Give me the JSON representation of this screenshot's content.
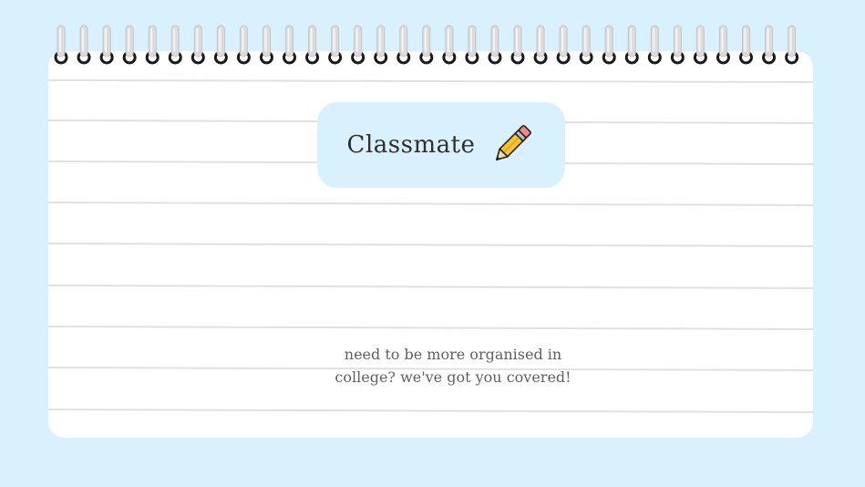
{
  "colors": {
    "background": "#d9f1fc",
    "paper": "#ffffff",
    "rule_line": "#e1e1e1",
    "title_card": "#d9f1fc",
    "spiral_ring": "#d8d8d8",
    "spiral_hole": "#1a1a1a"
  },
  "title": {
    "text": "Classmate",
    "icon": "pencil-icon"
  },
  "tagline": {
    "line1": "need to be more organised in",
    "line2": "college? we've got you covered!"
  }
}
